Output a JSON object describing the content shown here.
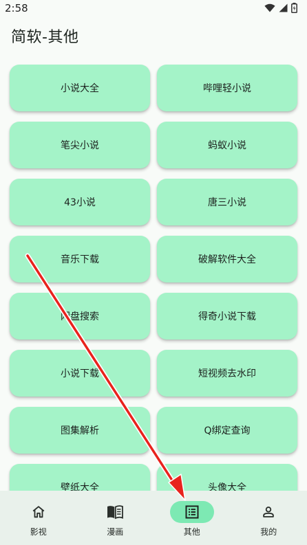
{
  "status_bar": {
    "time": "2:58",
    "icons": [
      "wifi-icon",
      "signal-icon",
      "battery-icon"
    ]
  },
  "header": {
    "title": "简软-其他"
  },
  "tiles": [
    {
      "label": "小说大全"
    },
    {
      "label": "哔哩轻小说"
    },
    {
      "label": "笔尖小说"
    },
    {
      "label": "蚂蚁小说"
    },
    {
      "label": "43小说"
    },
    {
      "label": "唐三小说"
    },
    {
      "label": "音乐下载"
    },
    {
      "label": "破解软件大全"
    },
    {
      "label": "网盘搜索"
    },
    {
      "label": "得奇小说下载"
    },
    {
      "label": "小说下载"
    },
    {
      "label": "短视频去水印"
    },
    {
      "label": "图集解析"
    },
    {
      "label": "Q绑定查询"
    },
    {
      "label": "壁纸大全"
    },
    {
      "label": "头像大全"
    }
  ],
  "bottom_nav": {
    "items": [
      {
        "label": "影视",
        "icon": "home-icon"
      },
      {
        "label": "漫画",
        "icon": "book-icon"
      },
      {
        "label": "其他",
        "icon": "list-icon",
        "active": true
      },
      {
        "label": "我的",
        "icon": "person-icon"
      }
    ]
  },
  "colors": {
    "background": "#f8fbf8",
    "tile": "#a4f3c8",
    "nav_background": "#e9f1eb",
    "nav_active_pill": "#7de9b3",
    "annotation_arrow": "#e8231d"
  }
}
